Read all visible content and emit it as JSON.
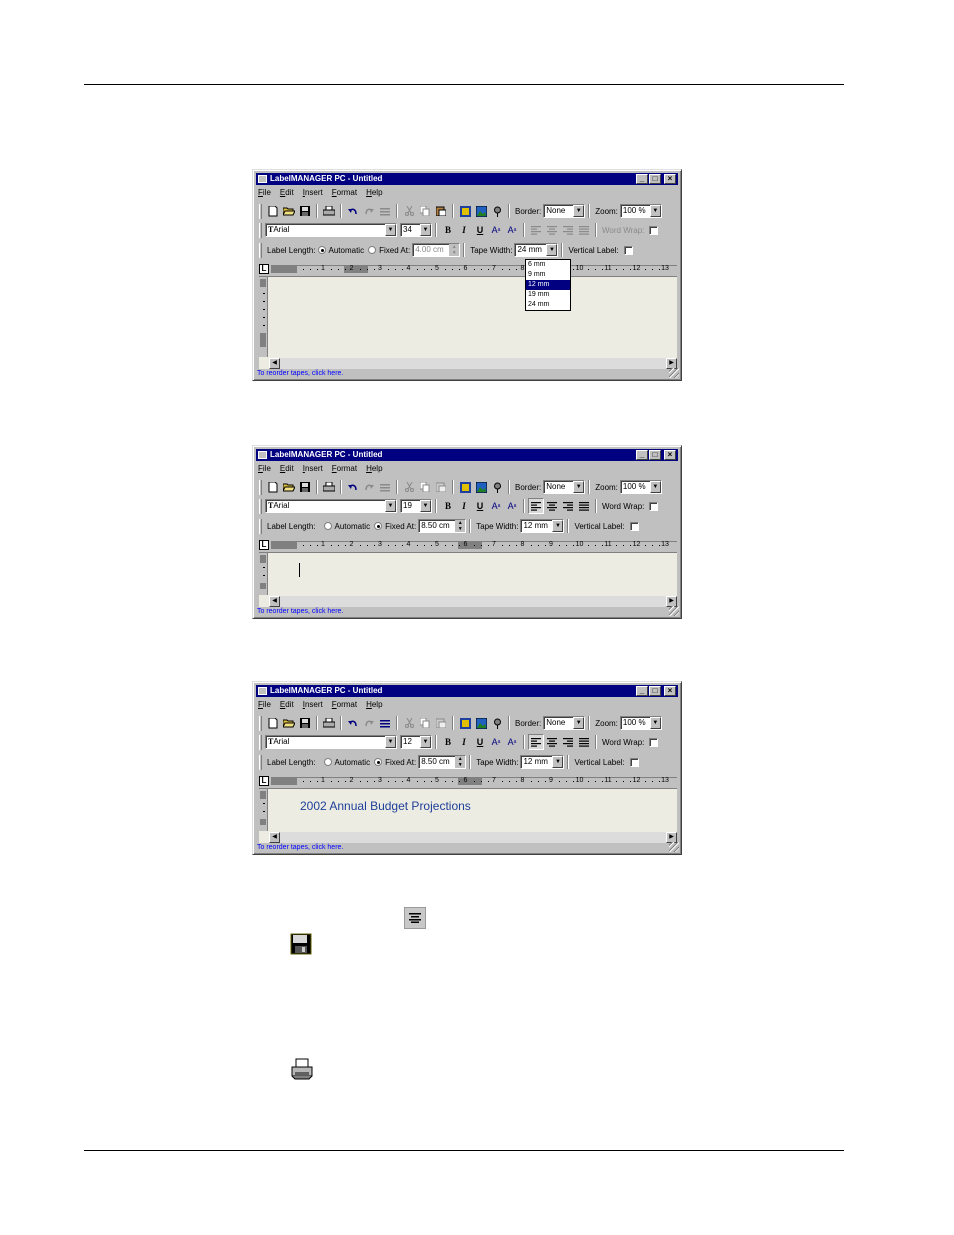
{
  "app": {
    "title": "LabelMANAGER PC - Untitled",
    "window_buttons": {
      "minimize": "_",
      "maximize": "□",
      "close": "×"
    },
    "menus": [
      "File",
      "Edit",
      "Insert",
      "Format",
      "Help"
    ],
    "toolbar": {
      "border_label": "Border:",
      "border_value": "None",
      "zoom_label": "Zoom:",
      "zoom_value": "100 %"
    },
    "format_toolbar": {
      "font_value": "Arial",
      "bold": "B",
      "italic": "I",
      "underline": "U",
      "superscript": "A",
      "subscript": "A",
      "word_wrap_label": "Word Wrap:"
    },
    "label_bar": {
      "label_length_label": "Label Length:",
      "automatic_label": "Automatic",
      "fixed_at_label": "Fixed At:",
      "tape_width_label": "Tape Width:",
      "vertical_label_label": "Vertical Label:"
    },
    "status_text": "To reorder tapes, click here.",
    "ruler_marks": [
      "1",
      "2",
      "3",
      "4",
      "5",
      "6",
      "7",
      "8",
      "9",
      "10",
      "11",
      "12",
      "13"
    ]
  },
  "windows": [
    {
      "font_size": "34",
      "label_length_mode": "automatic",
      "fixed_at_value": "4.00 cm",
      "tape_width_value": "24 mm",
      "word_wrap_enabled": false,
      "dropdown_open": true,
      "dropdown_options": [
        "6 mm",
        "9 mm",
        "12 mm",
        "19 mm",
        "24 mm"
      ],
      "dropdown_selected": "12 mm",
      "document_text": ""
    },
    {
      "font_size": "19",
      "label_length_mode": "fixed",
      "fixed_at_value": "8.50 cm",
      "tape_width_value": "12 mm",
      "word_wrap_enabled": true,
      "dropdown_open": false,
      "document_text": ""
    },
    {
      "font_size": "12",
      "label_length_mode": "fixed",
      "fixed_at_value": "8.50 cm",
      "tape_width_value": "12 mm",
      "word_wrap_enabled": true,
      "dropdown_open": false,
      "document_text": "2002 Annual Budget Projections"
    }
  ],
  "standalone_icons": [
    "center-align-icon",
    "save-icon",
    "print-icon"
  ]
}
